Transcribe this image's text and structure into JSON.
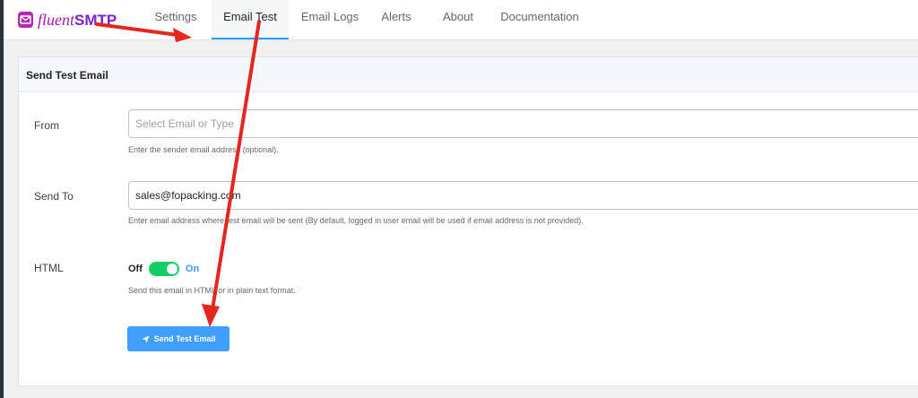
{
  "app": {
    "brand_part1": "fluent",
    "brand_part2": "SMTP"
  },
  "nav": {
    "tabs": [
      {
        "label": "Settings"
      },
      {
        "label": "Email Test"
      },
      {
        "label": "Email Logs"
      },
      {
        "label": "Alerts"
      },
      {
        "label": "About"
      },
      {
        "label": "Documentation"
      }
    ],
    "active_tab": "Email Test"
  },
  "panel": {
    "title": "Send Test Email"
  },
  "form": {
    "from": {
      "label": "From",
      "placeholder": "Select Email or Type",
      "help": "Enter the sender email address (optional)."
    },
    "send_to": {
      "label": "Send To",
      "value": "sales@fopacking.com",
      "help": "Enter email address where test email will be sent (By default, logged in user email will be used if email address is not provided)."
    },
    "html": {
      "label": "HTML",
      "off_label": "Off",
      "on_label": "On",
      "enabled": true,
      "help": "Send this email in HTML or in plain text format."
    },
    "submit_label": "Send Test Email"
  },
  "colors": {
    "accent": "#409eff",
    "toggle_on": "#13ce66",
    "brand": "#a21caf",
    "annotation": "#e5261e"
  },
  "icons": {
    "logo": "envelope-logo-icon",
    "submit": "paper-plane-icon"
  }
}
